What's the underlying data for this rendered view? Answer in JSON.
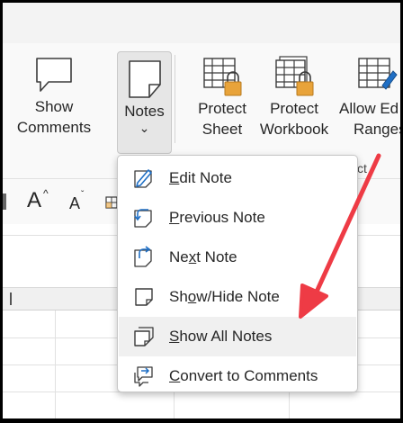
{
  "ribbon": {
    "show_comments": {
      "line1": "Show",
      "line2": "Comments"
    },
    "notes": {
      "label": "Notes",
      "caret": "⌄"
    },
    "protect_sheet": {
      "line1": "Protect",
      "line2": "Sheet"
    },
    "protect_workbook": {
      "line1": "Protect",
      "line2": "Workbook"
    },
    "allow_edit": {
      "line1": "Allow Ed",
      "line2": "Ranges"
    },
    "group_label_tail": "ct"
  },
  "format_row": {
    "font_grow": "A",
    "font_grow_caret": "^",
    "font_shrink": "A",
    "font_shrink_caret": "ˇ"
  },
  "notes_menu": {
    "items": [
      {
        "pre": "",
        "key": "E",
        "post": "dit Note",
        "icon": "edit-note-icon"
      },
      {
        "pre": "",
        "key": "P",
        "post": "revious Note",
        "icon": "previous-note-icon"
      },
      {
        "pre": "Ne",
        "key": "x",
        "post": "t Note",
        "icon": "next-note-icon"
      },
      {
        "pre": "Sh",
        "key": "o",
        "post": "w/Hide Note",
        "icon": "show-hide-note-icon"
      },
      {
        "pre": "",
        "key": "S",
        "post": "how All Notes",
        "icon": "show-all-notes-icon",
        "highlighted": true
      },
      {
        "pre": "",
        "key": "C",
        "post": "onvert to Comments",
        "icon": "convert-to-comments-icon"
      }
    ]
  },
  "colors": {
    "annotation_arrow": "#ee3b45",
    "lock": "#e8a33a",
    "accent_blue": "#1f6fc5",
    "menu_highlight": "#f0f0f0"
  }
}
